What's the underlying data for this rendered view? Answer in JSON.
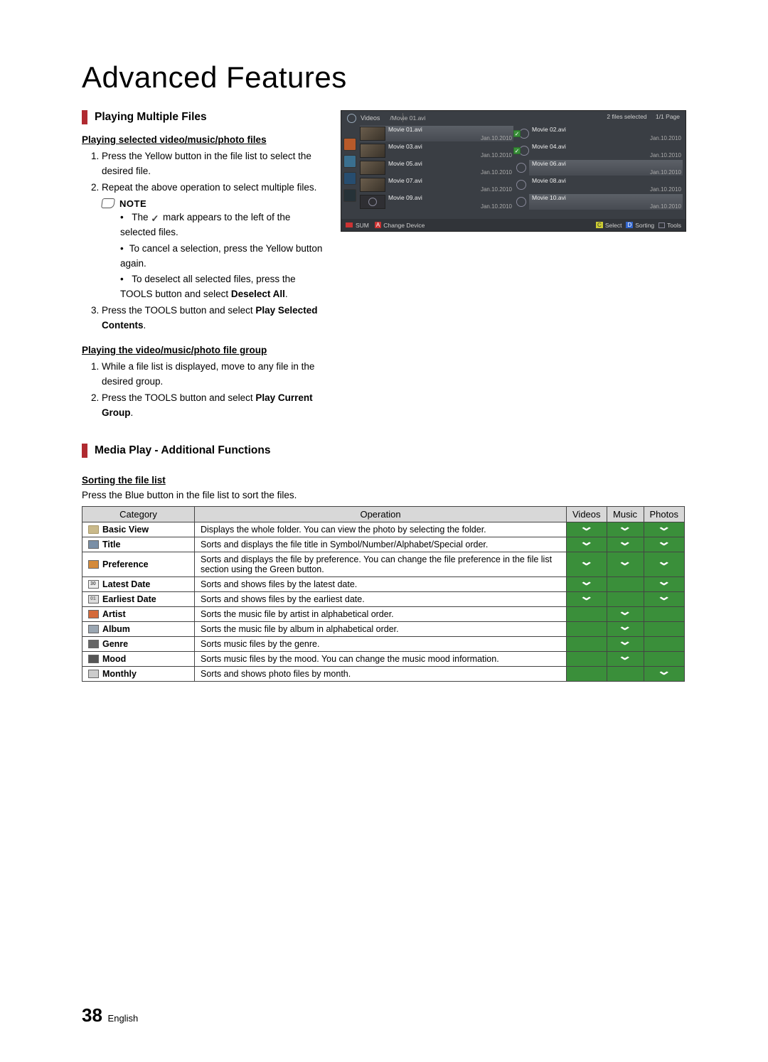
{
  "page_title": "Advanced Features",
  "section1": {
    "heading": "Playing Multiple Files",
    "sub1": "Playing selected video/music/photo files",
    "step1": "Press the Yellow button in the file list to select the desired file.",
    "step2": "Repeat the above operation to select multiple files.",
    "note_label": "NOTE",
    "bullet1a": "The ",
    "bullet1b": " mark appears to the left of the selected files.",
    "bullet2": "To cancel a selection, press the Yellow button again.",
    "bullet3a": "To deselect all selected files, press the TOOLS button and select ",
    "bullet3b": "Deselect All",
    "bullet3c": ".",
    "step3a": "Press the TOOLS button and select ",
    "step3b": "Play Selected Contents",
    "step3c": ".",
    "sub2": "Playing the video/music/photo file group",
    "grp_step1": "While a file list is displayed, move to any file in the desired group.",
    "grp_step2a": "Press the TOOLS button and select ",
    "grp_step2b": "Play Current Group",
    "grp_step2c": "."
  },
  "section2": {
    "heading": "Media Play - Additional Functions",
    "sub": "Sorting the file list",
    "intro": "Press the Blue button in the file list to sort the files."
  },
  "screenshot": {
    "crumb_root": "Videos",
    "crumb_path": "/Movie 01.avi",
    "status_selected": "2 files selected",
    "status_page": "1/1 Page",
    "date": "Jan.10.2010",
    "files": [
      "Movie 01.avi",
      "Movie 02.avi",
      "Movie 03.avi",
      "Movie 04.avi",
      "Movie 05.avi",
      "Movie 06.avi",
      "Movie 07.avi",
      "Movie 08.avi",
      "Movie 09.avi",
      "Movie 10.avi"
    ],
    "sum": "SUM",
    "foot_change": "Change Device",
    "foot_select": "Select",
    "foot_sorting": "Sorting",
    "foot_tools": "Tools",
    "key_a": "A",
    "key_c": "C",
    "key_d": "D"
  },
  "table": {
    "headers": {
      "category": "Category",
      "operation": "Operation",
      "videos": "Videos",
      "music": "Music",
      "photos": "Photos"
    },
    "rows": [
      {
        "icon": "ci-folder",
        "name": "Basic View",
        "op": "Displays the whole folder. You can view the photo by selecting the folder.",
        "v": true,
        "m": true,
        "p": true
      },
      {
        "icon": "ci-title",
        "name": "Title",
        "op": "Sorts and displays the file title in Symbol/Number/Alphabet/Special order.",
        "v": true,
        "m": true,
        "p": true
      },
      {
        "icon": "ci-pref",
        "name": "Preference",
        "op": "Sorts and displays the file by preference. You can change the file preference in the file list section using the Green button.",
        "v": true,
        "m": true,
        "p": true
      },
      {
        "icon": "ci-ldate",
        "name": "Latest Date",
        "op": "Sorts and shows files by the latest date.",
        "v": true,
        "m": false,
        "p": true
      },
      {
        "icon": "ci-edate",
        "name": "Earliest Date",
        "op": "Sorts and shows files by the earliest date.",
        "v": true,
        "m": false,
        "p": true
      },
      {
        "icon": "ci-artist",
        "name": "Artist",
        "op": "Sorts the music file by artist in alphabetical order.",
        "v": false,
        "m": true,
        "p": false
      },
      {
        "icon": "ci-album",
        "name": "Album",
        "op": "Sorts the music file by album in alphabetical order.",
        "v": false,
        "m": true,
        "p": false
      },
      {
        "icon": "ci-genre",
        "name": "Genre",
        "op": "Sorts music files by the genre.",
        "v": false,
        "m": true,
        "p": false
      },
      {
        "icon": "ci-mood",
        "name": "Mood",
        "op": "Sorts music files by the mood. You can change the music mood information.",
        "v": false,
        "m": true,
        "p": false
      },
      {
        "icon": "ci-month",
        "name": "Monthly",
        "op": "Sorts and shows photo files by month.",
        "v": false,
        "m": false,
        "p": true
      }
    ]
  },
  "footer": {
    "page_num": "38",
    "lang": "English"
  }
}
